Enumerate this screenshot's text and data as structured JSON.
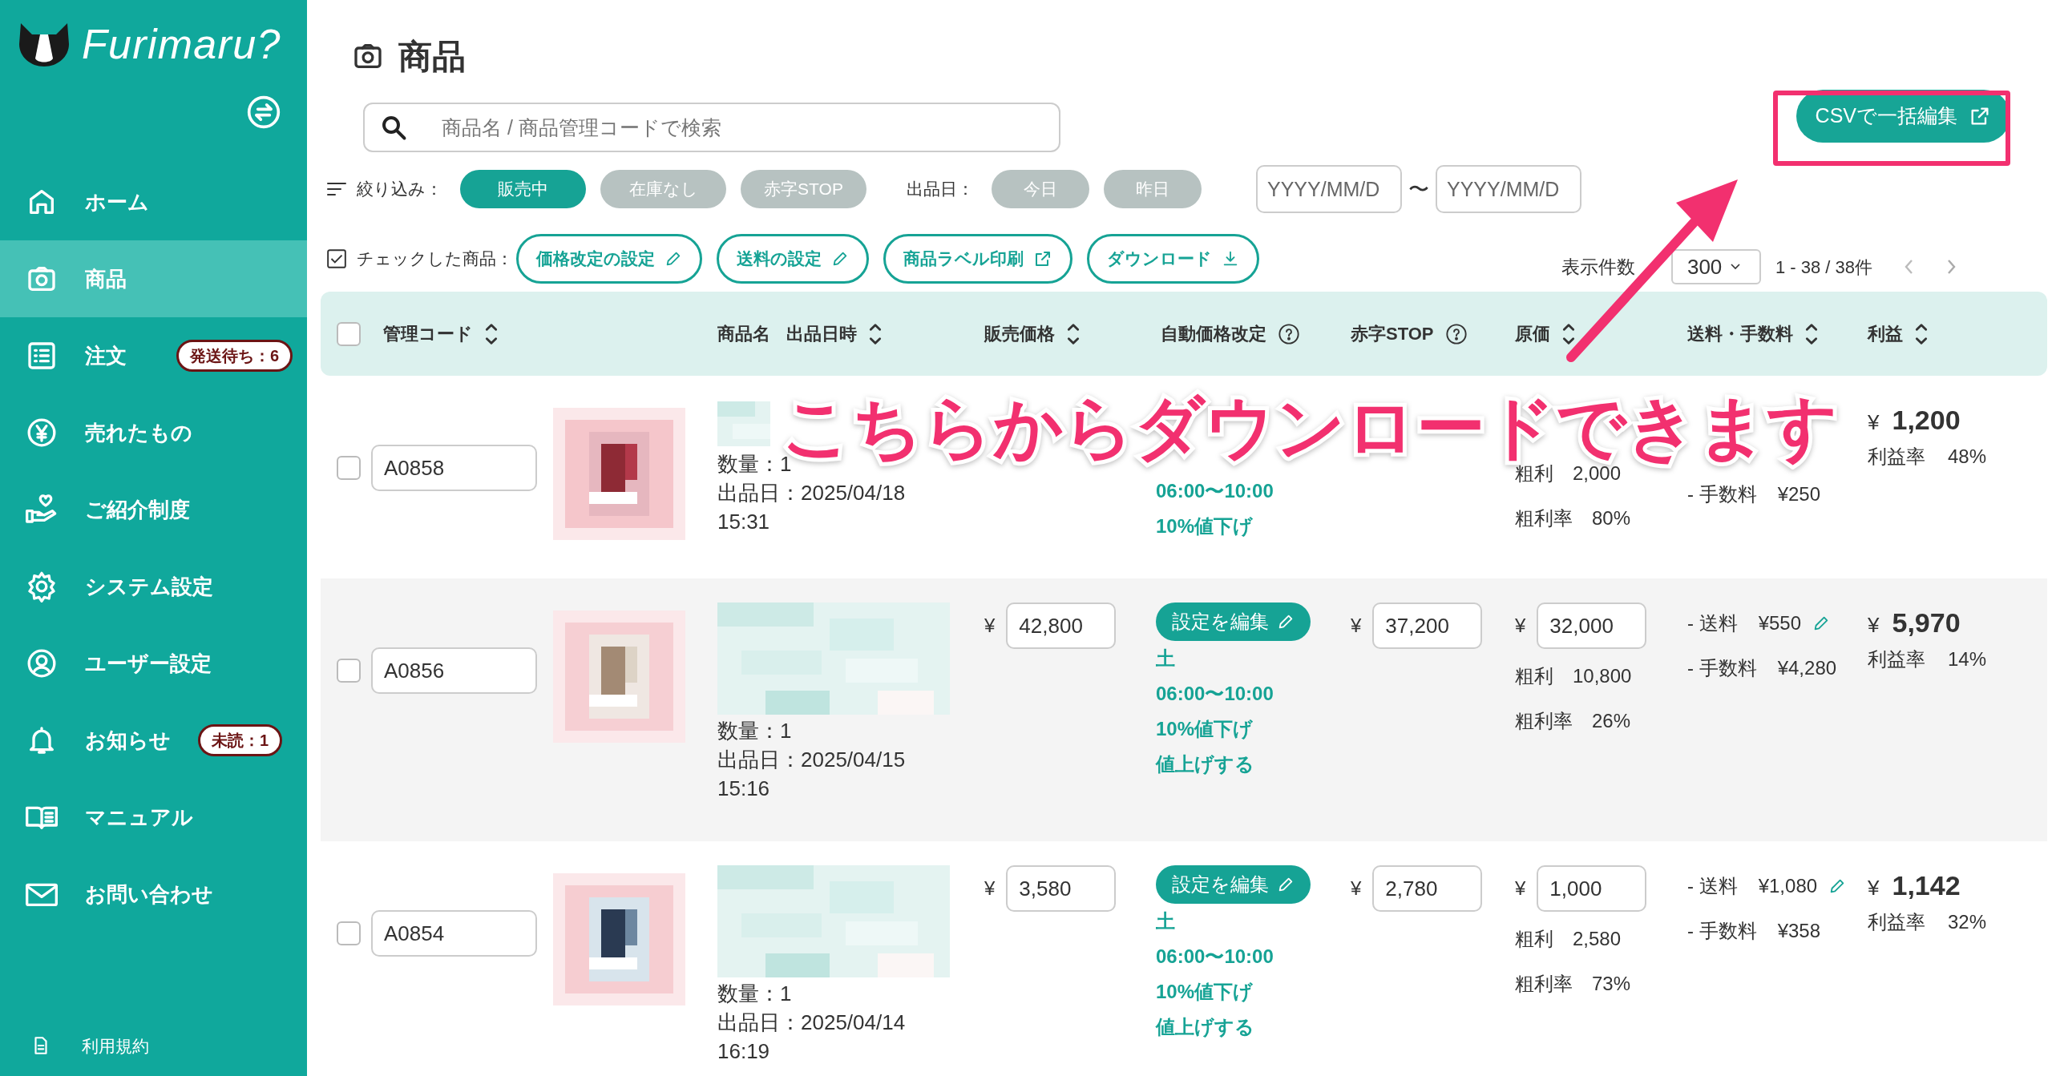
{
  "brand": {
    "name": "Furimaru?"
  },
  "sidebar": {
    "items": [
      {
        "kind": "home",
        "label": "ホーム",
        "selected": false
      },
      {
        "kind": "camera",
        "label": "商品",
        "selected": true
      },
      {
        "kind": "list",
        "label": "注文",
        "selected": false,
        "badge": "発送待ち：6"
      },
      {
        "kind": "yen",
        "label": "売れたもの",
        "selected": false
      },
      {
        "kind": "gift",
        "label": "ご紹介制度",
        "selected": false
      },
      {
        "kind": "gear",
        "label": "システム設定",
        "selected": false
      },
      {
        "kind": "user",
        "label": "ユーザー設定",
        "selected": false
      },
      {
        "kind": "bell",
        "label": "お知らせ",
        "selected": false,
        "badge": "未読：1"
      },
      {
        "kind": "book",
        "label": "マニュアル",
        "selected": false
      },
      {
        "kind": "mail",
        "label": "お問い合わせ",
        "selected": false
      }
    ],
    "footer_link": "利用規約"
  },
  "page": {
    "title": "商品"
  },
  "search": {
    "placeholder": "商品名 / 商品管理コードで検索"
  },
  "csv_button": "CSVで一括編集",
  "filters": {
    "label": "絞り込み：",
    "chips": [
      {
        "label": "販売中",
        "selected": true
      },
      {
        "label": "在庫なし",
        "selected": false
      },
      {
        "label": "赤字STOP",
        "selected": false
      }
    ],
    "date_label": "出品日：",
    "date_chips": [
      {
        "label": "今日",
        "selected": false
      },
      {
        "label": "昨日",
        "selected": false
      }
    ],
    "date_from": {
      "placeholder": "YYYY/MM/D"
    },
    "date_sep": "〜",
    "date_to": {
      "placeholder": "YYYY/MM/D"
    }
  },
  "bulk": {
    "label": "チェックした商品：",
    "actions": [
      {
        "label": "価格改定の設定",
        "kind": "edit"
      },
      {
        "label": "送料の設定",
        "kind": "edit"
      },
      {
        "label": "商品ラベル印刷",
        "kind": "print"
      },
      {
        "label": "ダウンロード",
        "kind": "download"
      }
    ]
  },
  "pagination": {
    "per_page_label": "表示件数",
    "per_page": "300",
    "range": "1 - 38 / 38件"
  },
  "table": {
    "all_checked": false,
    "columns": [
      {
        "label": "管理コード",
        "sortable": true,
        "help": false
      },
      {
        "label": "商品名",
        "sortable": false,
        "help": false
      },
      {
        "label": "出品日時",
        "sortable": true,
        "help": false
      },
      {
        "label": "販売価格",
        "sortable": true,
        "help": false
      },
      {
        "label": "自動価格改定",
        "sortable": false,
        "help": true
      },
      {
        "label": "赤字STOP",
        "sortable": false,
        "help": true
      },
      {
        "label": "原価",
        "sortable": true,
        "help": false
      },
      {
        "label": "送料・手数料",
        "sortable": true,
        "help": false
      },
      {
        "label": "利益",
        "sortable": true,
        "help": false
      }
    ],
    "rows": [
      {
        "checked": false,
        "code": "A0858",
        "quantity": "数量：1",
        "listed": "出品日：2025/04/18",
        "time": "15:31",
        "schedule": [
          "06:00〜10:00",
          "10%値下げ"
        ],
        "gross_label": "粗利",
        "gross": "2,000",
        "rate_label": "粗利率",
        "rate": "80%",
        "fees": [
          {
            "label": "- 手数料",
            "value": "¥250",
            "editable": false
          }
        ],
        "profit_currency": "¥",
        "profit": "1,200",
        "profit_rate_label": "利益率",
        "profit_rate": "48%"
      },
      {
        "checked": false,
        "code": "A0856",
        "quantity": "数量：1",
        "listed": "出品日：2025/04/15",
        "time": "15:16",
        "price_currency": "¥",
        "price": "42,800",
        "edit_button": "設定を編集",
        "schedule": [
          "土",
          "06:00〜10:00",
          "10%値下げ",
          "値上げする"
        ],
        "stop_currency": "¥",
        "stop_price": "37,200",
        "cost_currency": "¥",
        "cost": "32,000",
        "gross_label": "粗利",
        "gross": "10,800",
        "rate_label": "粗利率",
        "rate": "26%",
        "fees": [
          {
            "label": "- 送料",
            "value": "¥550",
            "editable": true
          },
          {
            "label": "- 手数料",
            "value": "¥4,280",
            "editable": false
          }
        ],
        "profit_currency": "¥",
        "profit": "5,970",
        "profit_rate_label": "利益率",
        "profit_rate": "14%"
      },
      {
        "checked": false,
        "code": "A0854",
        "quantity": "数量：1",
        "listed": "出品日：2025/04/14",
        "time": "16:19",
        "price_currency": "¥",
        "price": "3,580",
        "edit_button": "設定を編集",
        "schedule": [
          "土",
          "06:00〜10:00",
          "10%値下げ",
          "値上げする"
        ],
        "stop_currency": "¥",
        "stop_price": "2,780",
        "cost_currency": "¥",
        "cost": "1,000",
        "gross_label": "粗利",
        "gross": "2,580",
        "rate_label": "粗利率",
        "rate": "73%",
        "fees": [
          {
            "label": "- 送料",
            "value": "¥1,080",
            "editable": true
          },
          {
            "label": "- 手数料",
            "value": "¥358",
            "editable": false
          }
        ],
        "profit_currency": "¥",
        "profit": "1,142",
        "profit_rate_label": "利益率",
        "profit_rate": "32%"
      }
    ]
  },
  "annotation": {
    "text": "こちらからダウンロードできます"
  }
}
